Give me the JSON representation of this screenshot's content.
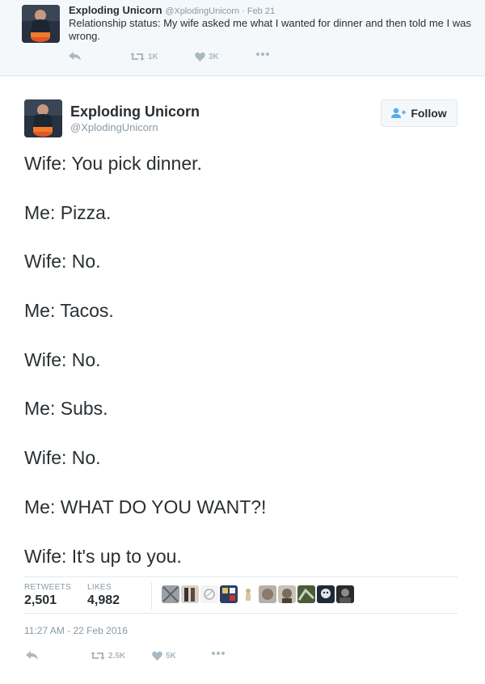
{
  "top_tweet": {
    "name": "Exploding Unicorn",
    "meta": "@XplodingUnicorn · Feb 21",
    "text": "Relationship status: My wife asked me what I wanted for dinner and then told me I was wrong.",
    "retweets": "1K",
    "likes": "3K",
    "icons": [
      "reply-icon",
      "retweet-icon",
      "heart-icon",
      "more-icon"
    ]
  },
  "main_tweet": {
    "name": "Exploding Unicorn",
    "handle": "@XplodingUnicorn",
    "follow_label": "Follow",
    "lines": [
      "Wife: You pick dinner.",
      "Me: Pizza.",
      "Wife: No.",
      "Me: Tacos.",
      "Wife: No.",
      "Me: Subs.",
      "Wife: No.",
      "Me: WHAT DO YOU WANT?!",
      "Wife: It's up to you."
    ],
    "retweets_label": "RETWEETS",
    "retweets_value": "2,501",
    "likes_label": "LIKES",
    "likes_value": "4,982",
    "timestamp": "11:27 AM - 22 Feb 2016",
    "action_retweets": "2.5K",
    "action_likes": "5K"
  },
  "colors": {
    "accent": "#55acee",
    "muted": "#8899a6",
    "icon": "#aab8c2",
    "text": "#292f33"
  }
}
